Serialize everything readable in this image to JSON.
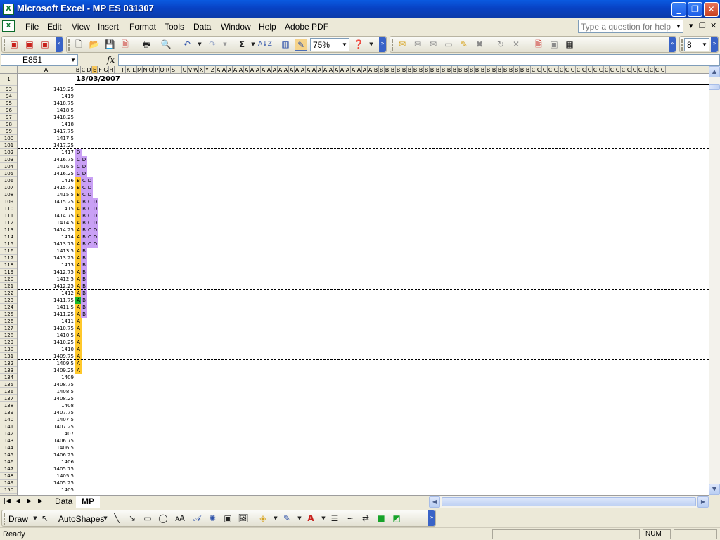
{
  "window": {
    "title": "Microsoft Excel - MP ES 031307",
    "min": "_",
    "restore": "❐",
    "close": "✕",
    "app_icon": "X"
  },
  "menu": {
    "doc_icon": "X",
    "items": [
      "File",
      "Edit",
      "View",
      "Insert",
      "Format",
      "Tools",
      "Data",
      "Window",
      "Help",
      "Adobe PDF"
    ],
    "help_placeholder": "Type a question for help",
    "mdi_min": "▾",
    "mdi_restore": "❐",
    "mdi_close": "✕"
  },
  "toolbar": {
    "zoom": "75%",
    "font_size": "8",
    "sigma": "Σ",
    "sort": "A↓Z"
  },
  "formula": {
    "name_box": "E851",
    "fx": "fx",
    "content": ""
  },
  "columns": {
    "A": "A",
    "letters": [
      "B",
      "C",
      "D",
      "E",
      "F",
      "G",
      "H",
      "I",
      "J",
      "K",
      "L",
      "M",
      "N",
      "O",
      "P",
      "Q",
      "R",
      "S",
      "T",
      "U",
      "V",
      "W",
      "X",
      "Y",
      "Z",
      "A",
      "A",
      "A",
      "A",
      "A",
      "A",
      "A",
      "A",
      "A",
      "A",
      "A",
      "A",
      "A",
      "A",
      "A",
      "A",
      "A",
      "A",
      "A",
      "A",
      "A",
      "A",
      "A",
      "A",
      "A",
      "A",
      "A",
      "A",
      "B",
      "B",
      "B",
      "B",
      "B",
      "B",
      "B",
      "B",
      "B",
      "B",
      "B",
      "B",
      "B",
      "B",
      "B",
      "B",
      "B",
      "B",
      "B",
      "B",
      "B",
      "B",
      "B",
      "B",
      "B",
      "B",
      "B",
      "B",
      "C",
      "C",
      "C",
      "C",
      "C",
      "C",
      "C",
      "C",
      "C",
      "C",
      "C",
      "C",
      "C",
      "C",
      "C",
      "C",
      "C",
      "C",
      "C",
      "C",
      "C",
      "C",
      "C",
      "C"
    ],
    "selected_index": 3
  },
  "sheet": {
    "header_row": "1",
    "date": "13/03/2007",
    "rows": [
      {
        "n": "93",
        "a": "1419.25"
      },
      {
        "n": "94",
        "a": "1419"
      },
      {
        "n": "95",
        "a": "1418.75"
      },
      {
        "n": "96",
        "a": "1418.5"
      },
      {
        "n": "97",
        "a": "1418.25"
      },
      {
        "n": "98",
        "a": "1418"
      },
      {
        "n": "99",
        "a": "1417.75"
      },
      {
        "n": "100",
        "a": "1417.5"
      },
      {
        "n": "101",
        "a": "1417.25"
      },
      {
        "n": "102",
        "a": "1417"
      },
      {
        "n": "103",
        "a": "1416.75"
      },
      {
        "n": "104",
        "a": "1416.5"
      },
      {
        "n": "105",
        "a": "1416.25"
      },
      {
        "n": "106",
        "a": "1416"
      },
      {
        "n": "107",
        "a": "1415.75"
      },
      {
        "n": "108",
        "a": "1415.5"
      },
      {
        "n": "109",
        "a": "1415.25"
      },
      {
        "n": "110",
        "a": "1415"
      },
      {
        "n": "111",
        "a": "1414.75"
      },
      {
        "n": "112",
        "a": "1414.5"
      },
      {
        "n": "113",
        "a": "1414.25"
      },
      {
        "n": "114",
        "a": "1414"
      },
      {
        "n": "115",
        "a": "1413.75"
      },
      {
        "n": "116",
        "a": "1413.5"
      },
      {
        "n": "117",
        "a": "1413.25"
      },
      {
        "n": "118",
        "a": "1413"
      },
      {
        "n": "119",
        "a": "1412.75"
      },
      {
        "n": "120",
        "a": "1412.5"
      },
      {
        "n": "121",
        "a": "1412.25"
      },
      {
        "n": "122",
        "a": "1412"
      },
      {
        "n": "123",
        "a": "1411.75"
      },
      {
        "n": "124",
        "a": "1411.5"
      },
      {
        "n": "125",
        "a": "1411.25"
      },
      {
        "n": "126",
        "a": "1411"
      },
      {
        "n": "127",
        "a": "1410.75"
      },
      {
        "n": "128",
        "a": "1410.5"
      },
      {
        "n": "129",
        "a": "1410.25"
      },
      {
        "n": "130",
        "a": "1410"
      },
      {
        "n": "131",
        "a": "1409.75"
      },
      {
        "n": "132",
        "a": "1409.5"
      },
      {
        "n": "133",
        "a": "1409.25"
      },
      {
        "n": "134",
        "a": "1409"
      },
      {
        "n": "135",
        "a": "1408.75"
      },
      {
        "n": "136",
        "a": "1408.5"
      },
      {
        "n": "137",
        "a": "1408.25"
      },
      {
        "n": "138",
        "a": "1408"
      },
      {
        "n": "139",
        "a": "1407.75"
      },
      {
        "n": "140",
        "a": "1407.5"
      },
      {
        "n": "141",
        "a": "1407.25"
      },
      {
        "n": "142",
        "a": "1407"
      },
      {
        "n": "143",
        "a": "1406.75"
      },
      {
        "n": "144",
        "a": "1406.5"
      },
      {
        "n": "145",
        "a": "1406.25"
      },
      {
        "n": "146",
        "a": "1406"
      },
      {
        "n": "147",
        "a": "1405.75"
      },
      {
        "n": "148",
        "a": "1405.5"
      },
      {
        "n": "149",
        "a": "1405.25"
      },
      {
        "n": "150",
        "a": "1405"
      }
    ],
    "profile": [
      {
        "row": 9,
        "cells": [
          {
            "c": 0,
            "t": "D",
            "p": "P"
          }
        ]
      },
      {
        "row": 10,
        "cells": [
          {
            "c": 0,
            "t": "C",
            "p": "P"
          },
          {
            "c": 1,
            "t": "D",
            "p": "P"
          }
        ]
      },
      {
        "row": 11,
        "cells": [
          {
            "c": 0,
            "t": "C",
            "p": "P"
          },
          {
            "c": 1,
            "t": "D",
            "p": "P"
          }
        ]
      },
      {
        "row": 12,
        "cells": [
          {
            "c": 0,
            "t": "C",
            "p": "P"
          },
          {
            "c": 1,
            "t": "D",
            "p": "P"
          }
        ]
      },
      {
        "row": 13,
        "cells": [
          {
            "c": 0,
            "t": "B",
            "p": "Y"
          },
          {
            "c": 1,
            "t": "C",
            "p": "P"
          },
          {
            "c": 2,
            "t": "D",
            "p": "P"
          }
        ]
      },
      {
        "row": 14,
        "cells": [
          {
            "c": 0,
            "t": "B",
            "p": "Y"
          },
          {
            "c": 1,
            "t": "C",
            "p": "P"
          },
          {
            "c": 2,
            "t": "D",
            "p": "P"
          }
        ]
      },
      {
        "row": 15,
        "cells": [
          {
            "c": 0,
            "t": "B",
            "p": "Y"
          },
          {
            "c": 1,
            "t": "C",
            "p": "P"
          },
          {
            "c": 2,
            "t": "D",
            "p": "P"
          }
        ]
      },
      {
        "row": 16,
        "cells": [
          {
            "c": 0,
            "t": "A",
            "p": "Y"
          },
          {
            "c": 1,
            "t": "B",
            "p": "P"
          },
          {
            "c": 2,
            "t": "C",
            "p": "P"
          },
          {
            "c": 3,
            "t": "D",
            "p": "P"
          }
        ]
      },
      {
        "row": 17,
        "cells": [
          {
            "c": 0,
            "t": "A",
            "p": "Y"
          },
          {
            "c": 1,
            "t": "B",
            "p": "P"
          },
          {
            "c": 2,
            "t": "C",
            "p": "P"
          },
          {
            "c": 3,
            "t": "D",
            "p": "P"
          }
        ]
      },
      {
        "row": 18,
        "cells": [
          {
            "c": 0,
            "t": "A",
            "p": "Y"
          },
          {
            "c": 1,
            "t": "B",
            "p": "P"
          },
          {
            "c": 2,
            "t": "C",
            "p": "P"
          },
          {
            "c": 3,
            "t": "D",
            "p": "P"
          }
        ]
      },
      {
        "row": 19,
        "cells": [
          {
            "c": 0,
            "t": "A",
            "p": "Y"
          },
          {
            "c": 1,
            "t": "B",
            "p": "P"
          },
          {
            "c": 2,
            "t": "C",
            "p": "P"
          },
          {
            "c": 3,
            "t": "D",
            "p": "P"
          }
        ]
      },
      {
        "row": 20,
        "cells": [
          {
            "c": 0,
            "t": "A",
            "p": "Y"
          },
          {
            "c": 1,
            "t": "B",
            "p": "P"
          },
          {
            "c": 2,
            "t": "C",
            "p": "P"
          },
          {
            "c": 3,
            "t": "D",
            "p": "P"
          }
        ]
      },
      {
        "row": 21,
        "cells": [
          {
            "c": 0,
            "t": "A",
            "p": "Y"
          },
          {
            "c": 1,
            "t": "B",
            "p": "P"
          },
          {
            "c": 2,
            "t": "C",
            "p": "P"
          },
          {
            "c": 3,
            "t": "D",
            "p": "P"
          }
        ]
      },
      {
        "row": 22,
        "cells": [
          {
            "c": 0,
            "t": "A",
            "p": "Y"
          },
          {
            "c": 1,
            "t": "B",
            "p": "P"
          },
          {
            "c": 2,
            "t": "C",
            "p": "P"
          },
          {
            "c": 3,
            "t": "D",
            "p": "P"
          }
        ]
      },
      {
        "row": 23,
        "cells": [
          {
            "c": 0,
            "t": "A",
            "p": "Y"
          },
          {
            "c": 1,
            "t": "B",
            "p": "P"
          }
        ]
      },
      {
        "row": 24,
        "cells": [
          {
            "c": 0,
            "t": "A",
            "p": "Y"
          },
          {
            "c": 1,
            "t": "B",
            "p": "P"
          }
        ]
      },
      {
        "row": 25,
        "cells": [
          {
            "c": 0,
            "t": "A",
            "p": "Y"
          },
          {
            "c": 1,
            "t": "B",
            "p": "P"
          }
        ]
      },
      {
        "row": 26,
        "cells": [
          {
            "c": 0,
            "t": "A",
            "p": "Y"
          },
          {
            "c": 1,
            "t": "B",
            "p": "P"
          }
        ]
      },
      {
        "row": 27,
        "cells": [
          {
            "c": 0,
            "t": "A",
            "p": "Y"
          },
          {
            "c": 1,
            "t": "B",
            "p": "P"
          }
        ]
      },
      {
        "row": 28,
        "cells": [
          {
            "c": 0,
            "t": "A",
            "p": "Y"
          },
          {
            "c": 1,
            "t": "B",
            "p": "P"
          }
        ]
      },
      {
        "row": 29,
        "cells": [
          {
            "c": 0,
            "t": "A",
            "p": "Y"
          },
          {
            "c": 1,
            "t": "B",
            "p": "P"
          }
        ]
      },
      {
        "row": 30,
        "cells": [
          {
            "c": 0,
            "t": "A",
            "p": "G"
          },
          {
            "c": 1,
            "t": "B",
            "p": "P"
          }
        ]
      },
      {
        "row": 31,
        "cells": [
          {
            "c": 0,
            "t": "A",
            "p": "Y"
          },
          {
            "c": 1,
            "t": "B",
            "p": "P"
          }
        ]
      },
      {
        "row": 32,
        "cells": [
          {
            "c": 0,
            "t": "A",
            "p": "Y"
          },
          {
            "c": 1,
            "t": "B",
            "p": "P"
          }
        ]
      },
      {
        "row": 33,
        "cells": [
          {
            "c": 0,
            "t": "A",
            "p": "Y"
          }
        ]
      },
      {
        "row": 34,
        "cells": [
          {
            "c": 0,
            "t": "A",
            "p": "Y"
          }
        ]
      },
      {
        "row": 35,
        "cells": [
          {
            "c": 0,
            "t": "A",
            "p": "Y"
          }
        ]
      },
      {
        "row": 36,
        "cells": [
          {
            "c": 0,
            "t": "A",
            "p": "Y"
          }
        ]
      },
      {
        "row": 37,
        "cells": [
          {
            "c": 0,
            "t": "A",
            "p": "Y"
          }
        ]
      },
      {
        "row": 38,
        "cells": [
          {
            "c": 0,
            "t": "A",
            "p": "Y"
          }
        ]
      },
      {
        "row": 39,
        "cells": [
          {
            "c": 0,
            "t": "A",
            "p": "Y"
          }
        ]
      },
      {
        "row": 40,
        "cells": [
          {
            "c": 0,
            "t": "A",
            "p": "Y"
          }
        ]
      }
    ],
    "dashed_after_rows": [
      9,
      19,
      29,
      39,
      49
    ]
  },
  "tabs": {
    "nav": [
      "|◀",
      "◀",
      "▶",
      "▶|"
    ],
    "items": [
      "Data",
      "MP"
    ],
    "active": 1
  },
  "drawing": {
    "draw": "Draw",
    "autoshapes": "AutoShapes"
  },
  "status": {
    "text": "Ready",
    "num": "NUM"
  },
  "colors": {
    "yellow": "#ffc82a",
    "purple": "#c9a0f5",
    "green": "#17b52a",
    "titlebar": "#0842c4"
  }
}
